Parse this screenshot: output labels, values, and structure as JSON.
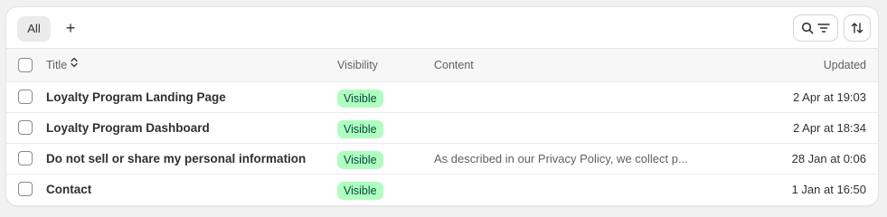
{
  "toolbar": {
    "tab_all_label": "All",
    "add_label": "+"
  },
  "table": {
    "columns": {
      "title": "Title",
      "visibility": "Visibility",
      "content": "Content",
      "updated": "Updated"
    },
    "rows": [
      {
        "title": "Loyalty Program Landing Page",
        "visibility": "Visible",
        "content": "",
        "updated": "2 Apr at 19:03"
      },
      {
        "title": "Loyalty Program Dashboard",
        "visibility": "Visible",
        "content": "",
        "updated": "2 Apr at 18:34"
      },
      {
        "title": "Do not sell or share my personal information",
        "visibility": "Visible",
        "content": "As described in our Privacy Policy, we collect p...",
        "updated": "28 Jan at 0:06"
      },
      {
        "title": "Contact",
        "visibility": "Visible",
        "content": "",
        "updated": "1 Jan at 16:50"
      }
    ]
  },
  "colors": {
    "badge_bg": "#affebf",
    "badge_text": "#014b40"
  },
  "icons": {
    "search": "search-icon",
    "filter": "filter-icon",
    "sort": "sort-icon",
    "sort_caret": "sort-caret-icon"
  }
}
